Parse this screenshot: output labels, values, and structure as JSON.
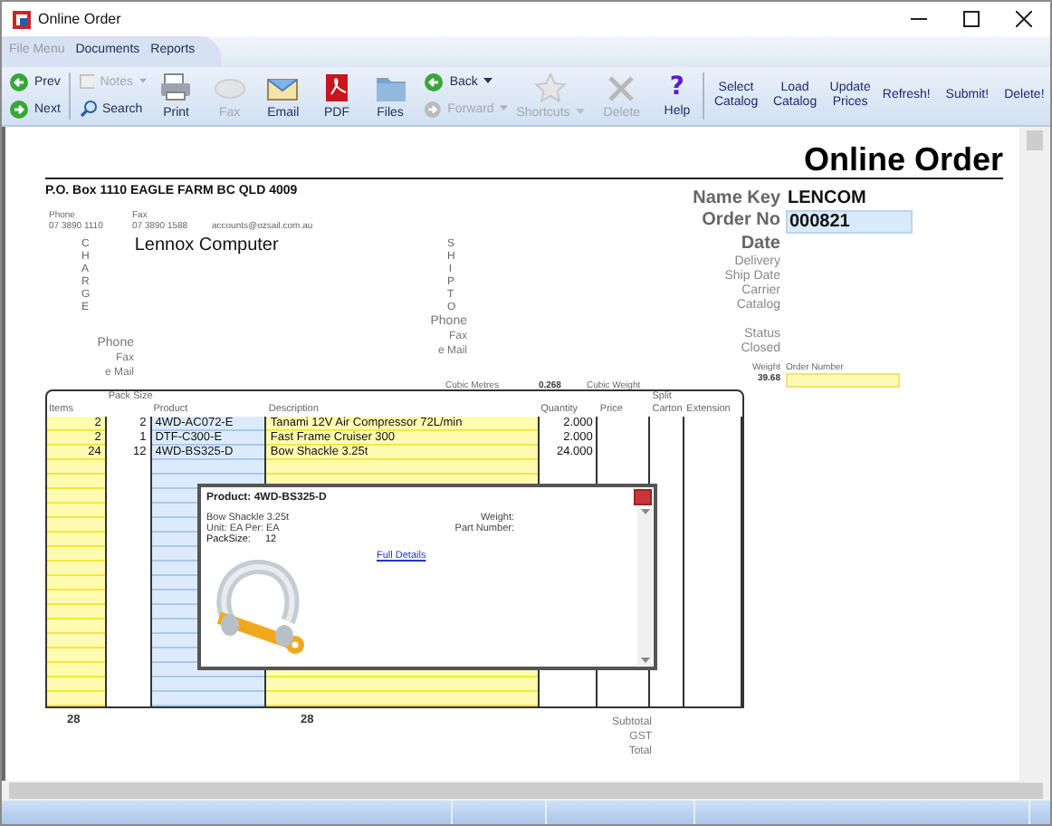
{
  "window": {
    "title": "Online Order"
  },
  "menu": [
    {
      "label": "File Menu",
      "disabled": true
    },
    {
      "label": "Documents",
      "disabled": false
    },
    {
      "label": "Reports",
      "disabled": false
    }
  ],
  "toolbar": {
    "nav": [
      {
        "label": "Prev",
        "disabled": false,
        "dropdown": false
      },
      {
        "label": "Next",
        "disabled": false,
        "dropdown": false
      }
    ],
    "notes": [
      {
        "label": "Notes",
        "disabled": true,
        "dropdown": true
      },
      {
        "label": "Search",
        "disabled": false,
        "dropdown": false
      }
    ],
    "large": [
      {
        "label": "Print",
        "disabled": false
      },
      {
        "label": "Fax",
        "disabled": true
      },
      {
        "label": "Email",
        "disabled": false
      },
      {
        "label": "PDF",
        "disabled": false
      },
      {
        "label": "Files",
        "disabled": false
      }
    ],
    "history": [
      {
        "label": "Back",
        "disabled": false,
        "dropdown": true
      },
      {
        "label": "Forward",
        "disabled": true,
        "dropdown": true
      }
    ],
    "large2": [
      {
        "label": "Shortcuts",
        "disabled": true,
        "dropdown": true
      },
      {
        "label": "Delete",
        "disabled": true,
        "dropdown": false
      },
      {
        "label": "Help",
        "disabled": false,
        "dropdown": false,
        "glyph": "?"
      }
    ],
    "actions": [
      "Select Catalog",
      "Load Catalog",
      "Update Prices",
      "Refresh!",
      "Submit!",
      "Delete!"
    ]
  },
  "form": {
    "title": "Online Order",
    "address": "P.O. Box 1110 EAGLE FARM BC QLD 4009",
    "contacts": [
      {
        "label": "Phone",
        "value": "07 3890 1110"
      },
      {
        "label": "Fax",
        "value": "07 3890 1588"
      },
      {
        "value": "accounts@ozsail.com.au"
      }
    ],
    "charge_to": {
      "letters": "CHARGE",
      "name": "Lennox Computer",
      "fields": [
        "Phone",
        "Fax",
        "e Mail"
      ]
    },
    "ship_to": {
      "letters": "SHIP TO",
      "fields": [
        "Phone",
        "Fax",
        "e Mail"
      ]
    },
    "cubic": {
      "metres_label": "Cubic Metres",
      "metres": "0.268",
      "weight_label": "Cubic Weight"
    },
    "info_main": [
      {
        "label": "Name Key",
        "value": "LENCOM",
        "kind": "text"
      },
      {
        "label": "Order No",
        "value": "000821",
        "kind": "field"
      },
      {
        "label": "Date"
      }
    ],
    "info_minor": [
      "Delivery",
      "Ship Date",
      "Carrier",
      "Catalog"
    ],
    "status_labels": [
      "Status",
      "Closed"
    ],
    "weight": {
      "label": "Weight",
      "value": "39.68"
    },
    "order_number": {
      "label": "Order Number"
    }
  },
  "table": {
    "pack_group": "Pack Size",
    "split_group": "Split",
    "columns": [
      "Items",
      "",
      "Product",
      "Description",
      "Quantity",
      "Price",
      "Carton",
      "Extension"
    ],
    "rows": [
      [
        "2",
        "2",
        "4WD-AC072-E",
        "Tanami 12V Air Compressor 72L/min",
        "2.000"
      ],
      [
        "2",
        "1",
        "DTF-C300-E",
        "Fast Frame Cruiser 300",
        "2.000"
      ],
      [
        "24",
        "12",
        "4WD-BS325-D",
        "Bow Shackle 3.25t",
        "24.000"
      ]
    ],
    "totals": [
      "28",
      "28"
    ],
    "summary_labels": [
      "Subtotal",
      "GST",
      "Total"
    ]
  },
  "popup": {
    "title": "Product: 4WD-BS325-D",
    "lines": [
      "Bow Shackle 3.25t",
      "Unit: EA  Per: EA"
    ],
    "pack_label": "PackSize:",
    "pack_value": "12",
    "right_labels": [
      "Weight:",
      "Part Number:"
    ],
    "link": "Full Details"
  }
}
